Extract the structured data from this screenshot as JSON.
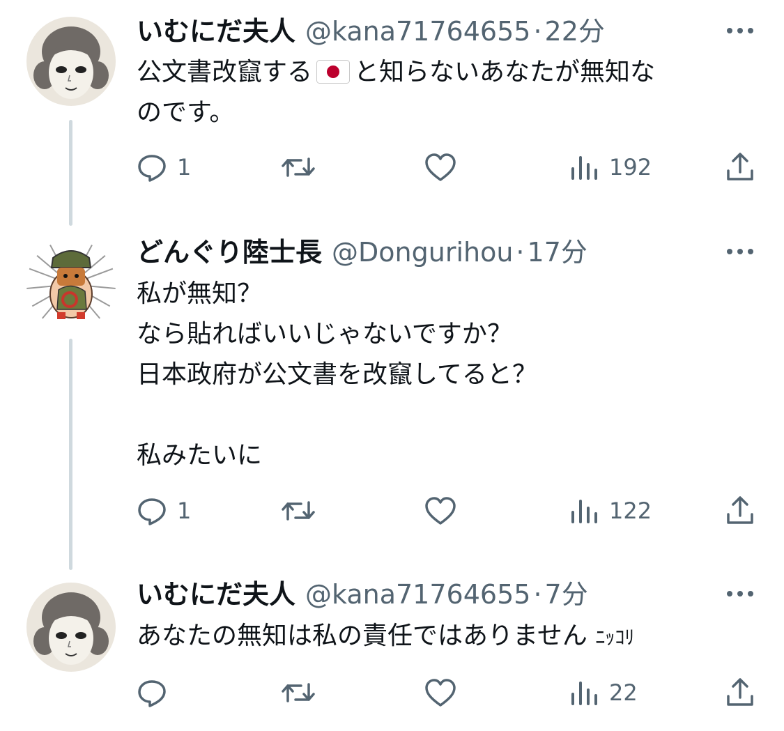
{
  "tweets": [
    {
      "author_name": "いむにだ夫人",
      "handle": "@kana71764655",
      "separator": "·",
      "time": "22分",
      "lines": [
        "公文書改竄する",
        "と知らないあなたが無知な",
        "のです。"
      ],
      "flag_icon": "japan-flag-icon",
      "reply_count": "1",
      "retweet_count": "",
      "like_count": "",
      "view_count": "192"
    },
    {
      "author_name": "どんぐり陸士長",
      "handle": "@Donguri hou",
      "handle_text": "@Dongurihou",
      "separator": "·",
      "time": "17分",
      "lines": [
        "私が無知？",
        "なら貼ればいいじゃないですか？",
        "日本政府が公文書を改竄してると？",
        "",
        "私みたいに"
      ],
      "reply_count": "1",
      "retweet_count": "",
      "like_count": "",
      "view_count": "122"
    },
    {
      "author_name": "いむにだ夫人",
      "handle": "@kana71764655",
      "separator": "·",
      "time": "7分",
      "lines": [
        "あなたの無知は私の責任ではありません"
      ],
      "trailing_small": "ﾆｯｺﾘ",
      "reply_count": "",
      "retweet_count": "",
      "like_count": "",
      "view_count": "22"
    }
  ],
  "icons": {
    "more": "more-horizontal-icon",
    "reply": "reply-icon",
    "retweet": "retweet-icon",
    "like": "heart-icon",
    "views": "views-chart-icon",
    "share": "share-icon"
  },
  "colors": {
    "text": "#0f1419",
    "secondary": "#536471",
    "thread_line": "#cfd9de",
    "flag_red": "#bc002d"
  }
}
